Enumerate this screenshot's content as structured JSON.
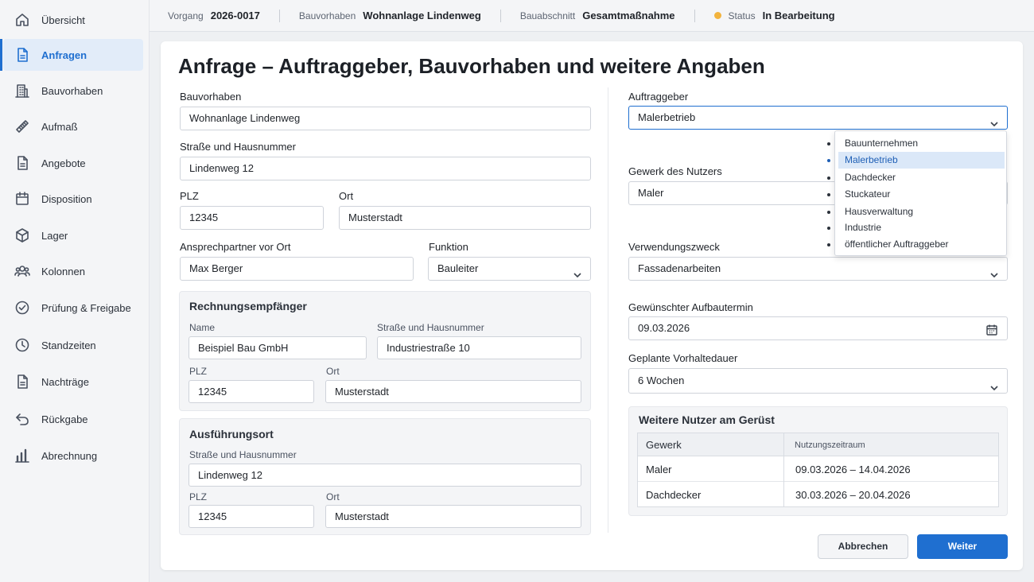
{
  "sidebar": {
    "items": [
      {
        "label": "Übersicht",
        "icon": "home-icon"
      },
      {
        "label": "Anfragen",
        "icon": "document-icon",
        "active": true
      },
      {
        "label": "Bauvorhaben",
        "icon": "building-icon"
      },
      {
        "label": "Aufmaß",
        "icon": "ruler-icon"
      },
      {
        "label": "Angebote",
        "icon": "document-icon"
      },
      {
        "label": "Disposition",
        "icon": "calendar-icon"
      },
      {
        "label": "Lager",
        "icon": "box-icon"
      },
      {
        "label": "Kolonnen",
        "icon": "team-icon"
      },
      {
        "label": "Prüfung & Freigabe",
        "icon": "check-circle-icon"
      },
      {
        "label": "Standzeiten",
        "icon": "clock-icon"
      },
      {
        "label": "Nachträge",
        "icon": "document-icon"
      },
      {
        "label": "Rückgabe",
        "icon": "undo-icon"
      },
      {
        "label": "Abrechnung",
        "icon": "bar-chart-icon"
      }
    ]
  },
  "topbar": {
    "vorgang_label": "Vorgang",
    "vorgang_value": "2026-0017",
    "bauvorhaben_label": "Bauvorhaben",
    "bauvorhaben_value": "Wohnanlage Lindenweg",
    "bauabschnitt_label": "Bauabschnitt",
    "bauabschnitt_value": "Gesamtmaßnahme",
    "status_label": "Status",
    "status_value": "In Bearbeitung",
    "status_color": "#f2b33d"
  },
  "form": {
    "title": "Anfrage – Auftraggeber, Bauvorhaben und weitere Angaben",
    "bauvorhaben": {
      "label": "Bauvorhaben",
      "value": "Wohnanlage Lindenweg"
    },
    "strasse": {
      "label": "Straße und Hausnummer",
      "value": "Lindenweg 12"
    },
    "plz": {
      "label": "PLZ",
      "value": "12345"
    },
    "ort": {
      "label": "Ort",
      "value": "Musterstadt"
    },
    "ansprechpartner": {
      "label": "Ansprechpartner vor Ort",
      "value": "Max Berger"
    },
    "funktion": {
      "label": "Funktion",
      "value": "Bauleiter"
    },
    "rechnungsempfaenger": {
      "title": "Rechnungsempfänger",
      "name_label": "Name",
      "name_value": "Beispiel Bau GmbH",
      "strasse_label": "Straße und Hausnummer",
      "strasse_value": "Industriestraße 10",
      "plz_label": "PLZ",
      "plz_value": "12345",
      "ort_label": "Ort",
      "ort_value": "Musterstadt"
    },
    "ausfuehrungsort": {
      "title": "Ausführungsort",
      "strasse_label": "Straße und Hausnummer",
      "strasse_value": "Lindenweg 12",
      "plz_label": "PLZ",
      "plz_value": "12345",
      "ort_label": "Ort",
      "ort_value": "Musterstadt"
    },
    "auftraggeber": {
      "label": "Auftraggeber",
      "value": "Malerbetrieb",
      "options": [
        "Bauunternehmen",
        "Malerbetrieb",
        "Dachdecker",
        "Stuckateur",
        "Hausverwaltung",
        "Industrie",
        "öffentlicher Auftraggeber"
      ]
    },
    "gewerk": {
      "label": "Gewerk des Nutzers",
      "value": "Maler"
    },
    "verwendungszweck": {
      "label": "Verwendungszweck",
      "value": "Fassadenarbeiten"
    },
    "aufbautermin": {
      "label": "Gewünschter Aufbautermin",
      "value": "09.03.2026"
    },
    "vorhaltedauer": {
      "label": "Geplante Vorhaltedauer",
      "value": "6 Wochen"
    },
    "weitere_nutzer": {
      "title": "Weitere Nutzer am Gerüst",
      "col_gewerk": "Gewerk",
      "col_zeitraum": "Nutzungszeitraum",
      "rows": [
        {
          "gewerk": "Maler",
          "zeitraum": "09.03.2026 – 14.04.2026"
        },
        {
          "gewerk": "Dachdecker",
          "zeitraum": "30.03.2026 – 20.04.2026"
        }
      ]
    },
    "buttons": {
      "cancel": "Abbrechen",
      "next": "Weiter"
    }
  },
  "colors": {
    "accent": "#1f6fd0",
    "status": "#f2b33d"
  }
}
